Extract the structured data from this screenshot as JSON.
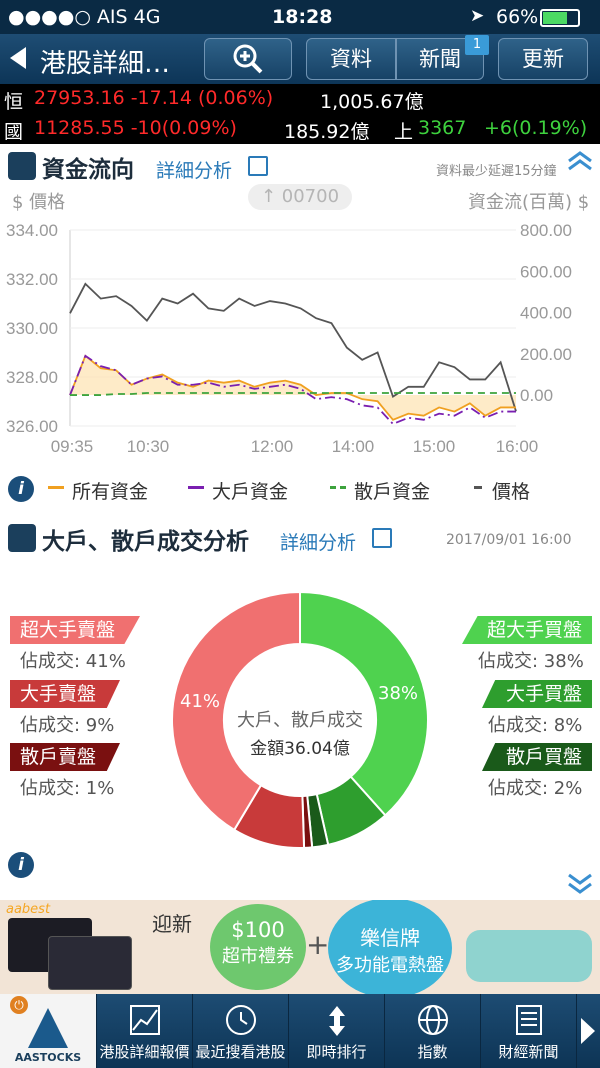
{
  "status": {
    "carrier": "●●●●○ AIS   4G",
    "time": "18:28",
    "battery": "66%"
  },
  "nav": {
    "title": "港股詳細…",
    "data_label": "資料",
    "news_label": "新聞",
    "news_badge": "1",
    "refresh_label": "更新",
    "zoom_icon": "magnifier-plus-icon"
  },
  "ticker": {
    "row1": {
      "name": "恒",
      "quote": "27953.16 -17.14 (0.06%)",
      "turnover": "1,005.67億"
    },
    "row2": {
      "name": "國",
      "quote": "11285.55 -10(0.09%)",
      "turnover": "185.92億",
      "sh_label": "上",
      "sh_value": "3367",
      "sh_change": "+6(0.19%)"
    }
  },
  "fund_flow": {
    "title": "資金流向",
    "detail_link": "詳細分析",
    "delay_note": "資料最少延遲15分鐘",
    "price_label": "$ 價格",
    "flow_label": "資金流(百萬) $",
    "stock_code": "↑ 00700"
  },
  "colors": {
    "all_funds": "#f0a020",
    "large_funds": "#7a1fb0",
    "retail_funds": "#3da33d",
    "price": "#555555",
    "super_sell": "#f07070",
    "large_sell": "#c83a3a",
    "retail_sell": "#7a1010",
    "super_buy": "#4fd24f",
    "large_buy": "#2e9e2e",
    "retail_buy": "#1a5a1a"
  },
  "chart_data": {
    "type": "line",
    "x_ticks": [
      "09:35",
      "10:30",
      "12:00",
      "14:00",
      "15:00",
      "16:00"
    ],
    "y_left": {
      "label": "$ 價格",
      "ticks": [
        "334.00",
        "332.00",
        "330.00",
        "328.00",
        "326.00"
      ],
      "range": [
        326,
        334
      ]
    },
    "y_right": {
      "label": "資金流(百萬) $",
      "ticks": [
        "800.00",
        "600.00",
        "400.00",
        "200.00",
        "0.00"
      ],
      "range": [
        -150,
        800
      ]
    },
    "legend": [
      "所有資金",
      "大戶資金",
      "散戶資金",
      "價格"
    ],
    "series": [
      {
        "name": "價格",
        "axis": "left",
        "values": [
          330.6,
          331.8,
          331.2,
          331.3,
          330.9,
          330.3,
          331.2,
          331.0,
          331.4,
          330.8,
          330.7,
          331.2,
          330.9,
          331.1,
          331.0,
          330.8,
          330.4,
          330.2,
          329.2,
          328.7,
          329.0,
          327.2,
          327.6,
          327.6,
          328.6,
          328.4,
          327.9,
          327.9,
          328.6,
          326.6
        ]
      },
      {
        "name": "所有資金",
        "axis": "right",
        "values": [
          0,
          190,
          130,
          120,
          50,
          80,
          100,
          60,
          40,
          70,
          60,
          70,
          40,
          60,
          70,
          50,
          0,
          10,
          10,
          -20,
          -30,
          -120,
          -90,
          -100,
          -60,
          -80,
          -40,
          -100,
          -60,
          -60
        ]
      },
      {
        "name": "大戶資金",
        "axis": "right",
        "values": [
          0,
          190,
          140,
          120,
          50,
          80,
          90,
          50,
          50,
          60,
          40,
          50,
          30,
          40,
          50,
          30,
          -20,
          -10,
          -20,
          -50,
          -60,
          -140,
          -110,
          -120,
          -90,
          -100,
          -60,
          -110,
          -80,
          -80
        ]
      },
      {
        "name": "散戶資金",
        "axis": "right",
        "values": [
          0,
          0,
          0,
          5,
          5,
          10,
          10,
          10,
          10,
          10,
          10,
          10,
          10,
          10,
          10,
          10,
          10,
          10,
          10,
          10,
          10,
          10,
          10,
          10,
          10,
          10,
          10,
          10,
          10,
          10
        ]
      }
    ]
  },
  "trade_analysis": {
    "title": "大戶、散戶成交分析",
    "detail_link": "詳細分析",
    "timestamp": "2017/09/01 16:00",
    "center_title": "大戶、散戶成交",
    "center_amount": "金額36.04億",
    "sell_super_label": "超大手賣盤",
    "sell_super_share": "佔成交: 41%",
    "sell_large_label": "大手賣盤",
    "sell_large_share": "佔成交: 9%",
    "sell_retail_label": "散戶賣盤",
    "sell_retail_share": "佔成交: 1%",
    "buy_super_label": "超大手買盤",
    "buy_super_share": "佔成交: 38%",
    "buy_large_label": "大手買盤",
    "buy_large_share": "佔成交: 8%",
    "buy_retail_label": "散戶買盤",
    "buy_retail_share": "佔成交: 2%",
    "slice_label_left": "41%",
    "slice_label_right": "38%"
  },
  "donut_data": {
    "type": "pie",
    "slices": [
      {
        "name": "超大手買盤",
        "value": 38
      },
      {
        "name": "大手買盤",
        "value": 8
      },
      {
        "name": "散戶買盤",
        "value": 2
      },
      {
        "name": "散戶賣盤",
        "value": 1
      },
      {
        "name": "大手賣盤",
        "value": 9
      },
      {
        "name": "超大手賣盤",
        "value": 41
      }
    ]
  },
  "ad": {
    "brand": "aabest",
    "text1": "迎新",
    "coupon_amount": "$100",
    "coupon_text": "超市禮券",
    "plus": "+",
    "gift_brand": "樂信牌",
    "gift_text": "多功能電熱盤"
  },
  "tabs": [
    {
      "label": "AASTOCKS",
      "icon": "aastocks-logo-icon"
    },
    {
      "label": "港股詳細報價",
      "icon": "chart-icon"
    },
    {
      "label": "最近搜看港股",
      "icon": "clock-icon"
    },
    {
      "label": "即時排行",
      "icon": "sort-arrows-icon"
    },
    {
      "label": "指數",
      "icon": "globe-icon"
    },
    {
      "label": "財經新聞",
      "icon": "newspaper-icon"
    }
  ]
}
